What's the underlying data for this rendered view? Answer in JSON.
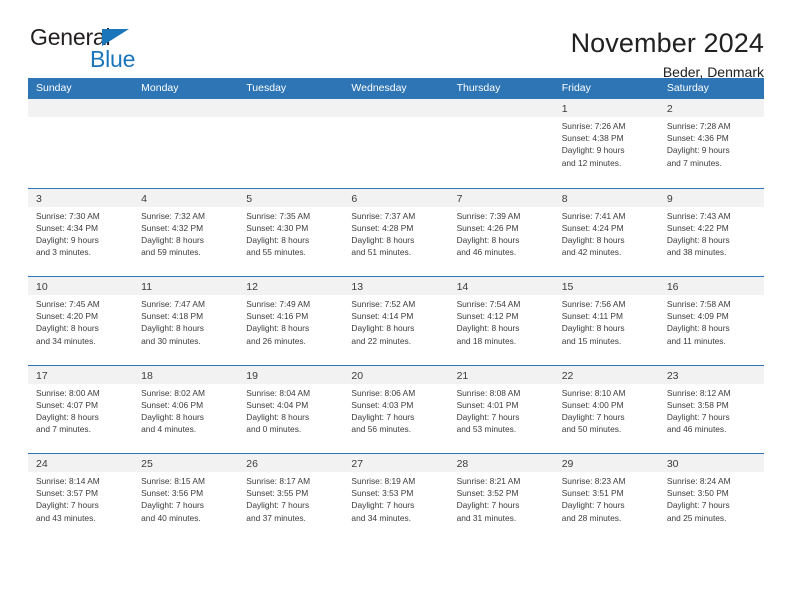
{
  "brand": {
    "name_part1": "General",
    "name_part2": "Blue",
    "triangle_color": "#1b75bb"
  },
  "header": {
    "month_title": "November 2024",
    "location": "Beder, Denmark"
  },
  "calendar": {
    "header_color": "#2e75b6",
    "weekdays": [
      "Sunday",
      "Monday",
      "Tuesday",
      "Wednesday",
      "Thursday",
      "Friday",
      "Saturday"
    ],
    "weeks": [
      [
        {
          "empty": true
        },
        {
          "empty": true
        },
        {
          "empty": true
        },
        {
          "empty": true
        },
        {
          "empty": true
        },
        {
          "day": "1",
          "sunrise": "Sunrise: 7:26 AM",
          "sunset": "Sunset: 4:38 PM",
          "daylight_line1": "Daylight: 9 hours",
          "daylight_line2": "and 12 minutes."
        },
        {
          "day": "2",
          "sunrise": "Sunrise: 7:28 AM",
          "sunset": "Sunset: 4:36 PM",
          "daylight_line1": "Daylight: 9 hours",
          "daylight_line2": "and 7 minutes."
        }
      ],
      [
        {
          "day": "3",
          "sunrise": "Sunrise: 7:30 AM",
          "sunset": "Sunset: 4:34 PM",
          "daylight_line1": "Daylight: 9 hours",
          "daylight_line2": "and 3 minutes."
        },
        {
          "day": "4",
          "sunrise": "Sunrise: 7:32 AM",
          "sunset": "Sunset: 4:32 PM",
          "daylight_line1": "Daylight: 8 hours",
          "daylight_line2": "and 59 minutes."
        },
        {
          "day": "5",
          "sunrise": "Sunrise: 7:35 AM",
          "sunset": "Sunset: 4:30 PM",
          "daylight_line1": "Daylight: 8 hours",
          "daylight_line2": "and 55 minutes."
        },
        {
          "day": "6",
          "sunrise": "Sunrise: 7:37 AM",
          "sunset": "Sunset: 4:28 PM",
          "daylight_line1": "Daylight: 8 hours",
          "daylight_line2": "and 51 minutes."
        },
        {
          "day": "7",
          "sunrise": "Sunrise: 7:39 AM",
          "sunset": "Sunset: 4:26 PM",
          "daylight_line1": "Daylight: 8 hours",
          "daylight_line2": "and 46 minutes."
        },
        {
          "day": "8",
          "sunrise": "Sunrise: 7:41 AM",
          "sunset": "Sunset: 4:24 PM",
          "daylight_line1": "Daylight: 8 hours",
          "daylight_line2": "and 42 minutes."
        },
        {
          "day": "9",
          "sunrise": "Sunrise: 7:43 AM",
          "sunset": "Sunset: 4:22 PM",
          "daylight_line1": "Daylight: 8 hours",
          "daylight_line2": "and 38 minutes."
        }
      ],
      [
        {
          "day": "10",
          "sunrise": "Sunrise: 7:45 AM",
          "sunset": "Sunset: 4:20 PM",
          "daylight_line1": "Daylight: 8 hours",
          "daylight_line2": "and 34 minutes."
        },
        {
          "day": "11",
          "sunrise": "Sunrise: 7:47 AM",
          "sunset": "Sunset: 4:18 PM",
          "daylight_line1": "Daylight: 8 hours",
          "daylight_line2": "and 30 minutes."
        },
        {
          "day": "12",
          "sunrise": "Sunrise: 7:49 AM",
          "sunset": "Sunset: 4:16 PM",
          "daylight_line1": "Daylight: 8 hours",
          "daylight_line2": "and 26 minutes."
        },
        {
          "day": "13",
          "sunrise": "Sunrise: 7:52 AM",
          "sunset": "Sunset: 4:14 PM",
          "daylight_line1": "Daylight: 8 hours",
          "daylight_line2": "and 22 minutes."
        },
        {
          "day": "14",
          "sunrise": "Sunrise: 7:54 AM",
          "sunset": "Sunset: 4:12 PM",
          "daylight_line1": "Daylight: 8 hours",
          "daylight_line2": "and 18 minutes."
        },
        {
          "day": "15",
          "sunrise": "Sunrise: 7:56 AM",
          "sunset": "Sunset: 4:11 PM",
          "daylight_line1": "Daylight: 8 hours",
          "daylight_line2": "and 15 minutes."
        },
        {
          "day": "16",
          "sunrise": "Sunrise: 7:58 AM",
          "sunset": "Sunset: 4:09 PM",
          "daylight_line1": "Daylight: 8 hours",
          "daylight_line2": "and 11 minutes."
        }
      ],
      [
        {
          "day": "17",
          "sunrise": "Sunrise: 8:00 AM",
          "sunset": "Sunset: 4:07 PM",
          "daylight_line1": "Daylight: 8 hours",
          "daylight_line2": "and 7 minutes."
        },
        {
          "day": "18",
          "sunrise": "Sunrise: 8:02 AM",
          "sunset": "Sunset: 4:06 PM",
          "daylight_line1": "Daylight: 8 hours",
          "daylight_line2": "and 4 minutes."
        },
        {
          "day": "19",
          "sunrise": "Sunrise: 8:04 AM",
          "sunset": "Sunset: 4:04 PM",
          "daylight_line1": "Daylight: 8 hours",
          "daylight_line2": "and 0 minutes."
        },
        {
          "day": "20",
          "sunrise": "Sunrise: 8:06 AM",
          "sunset": "Sunset: 4:03 PM",
          "daylight_line1": "Daylight: 7 hours",
          "daylight_line2": "and 56 minutes."
        },
        {
          "day": "21",
          "sunrise": "Sunrise: 8:08 AM",
          "sunset": "Sunset: 4:01 PM",
          "daylight_line1": "Daylight: 7 hours",
          "daylight_line2": "and 53 minutes."
        },
        {
          "day": "22",
          "sunrise": "Sunrise: 8:10 AM",
          "sunset": "Sunset: 4:00 PM",
          "daylight_line1": "Daylight: 7 hours",
          "daylight_line2": "and 50 minutes."
        },
        {
          "day": "23",
          "sunrise": "Sunrise: 8:12 AM",
          "sunset": "Sunset: 3:58 PM",
          "daylight_line1": "Daylight: 7 hours",
          "daylight_line2": "and 46 minutes."
        }
      ],
      [
        {
          "day": "24",
          "sunrise": "Sunrise: 8:14 AM",
          "sunset": "Sunset: 3:57 PM",
          "daylight_line1": "Daylight: 7 hours",
          "daylight_line2": "and 43 minutes."
        },
        {
          "day": "25",
          "sunrise": "Sunrise: 8:15 AM",
          "sunset": "Sunset: 3:56 PM",
          "daylight_line1": "Daylight: 7 hours",
          "daylight_line2": "and 40 minutes."
        },
        {
          "day": "26",
          "sunrise": "Sunrise: 8:17 AM",
          "sunset": "Sunset: 3:55 PM",
          "daylight_line1": "Daylight: 7 hours",
          "daylight_line2": "and 37 minutes."
        },
        {
          "day": "27",
          "sunrise": "Sunrise: 8:19 AM",
          "sunset": "Sunset: 3:53 PM",
          "daylight_line1": "Daylight: 7 hours",
          "daylight_line2": "and 34 minutes."
        },
        {
          "day": "28",
          "sunrise": "Sunrise: 8:21 AM",
          "sunset": "Sunset: 3:52 PM",
          "daylight_line1": "Daylight: 7 hours",
          "daylight_line2": "and 31 minutes."
        },
        {
          "day": "29",
          "sunrise": "Sunrise: 8:23 AM",
          "sunset": "Sunset: 3:51 PM",
          "daylight_line1": "Daylight: 7 hours",
          "daylight_line2": "and 28 minutes."
        },
        {
          "day": "30",
          "sunrise": "Sunrise: 8:24 AM",
          "sunset": "Sunset: 3:50 PM",
          "daylight_line1": "Daylight: 7 hours",
          "daylight_line2": "and 25 minutes."
        }
      ]
    ]
  }
}
